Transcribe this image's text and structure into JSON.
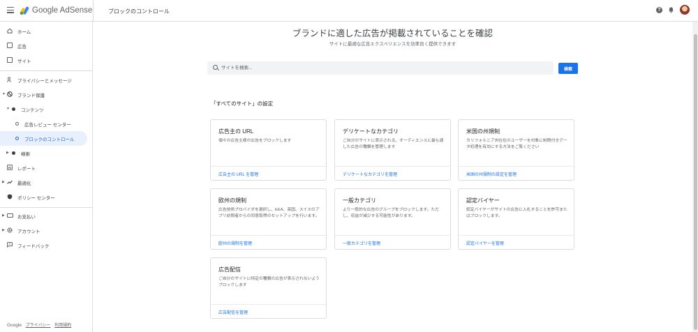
{
  "app": {
    "brand": "Google AdSense",
    "page_title": "ブロックのコントロール"
  },
  "sidebar": {
    "items": [
      {
        "label": "ホーム",
        "icon": "home-icon"
      },
      {
        "label": "広告",
        "icon": "ads-icon"
      },
      {
        "label": "サイト",
        "icon": "sites-icon"
      },
      {
        "label": "プライバシーとメッセージ",
        "icon": "privacy-icon"
      },
      {
        "label": "ブランド保護",
        "icon": "block-icon"
      },
      {
        "label": "コンテンツ",
        "icon": "dot-icon"
      },
      {
        "label": "広告レビュー センター",
        "icon": "ring-icon"
      },
      {
        "label": "ブロックのコントロール",
        "icon": "ring-icon"
      },
      {
        "label": "検索",
        "icon": "dot-icon"
      },
      {
        "label": "レポート",
        "icon": "reports-icon"
      },
      {
        "label": "最適化",
        "icon": "trending-icon"
      },
      {
        "label": "ポリシー センター",
        "icon": "policy-shield-icon"
      },
      {
        "label": "お支払い",
        "icon": "payments-icon"
      },
      {
        "label": "アカウント",
        "icon": "gear-icon"
      },
      {
        "label": "フィードバック",
        "icon": "feedback-icon"
      }
    ],
    "footer": {
      "google": "Google",
      "privacy": "プライバシー",
      "terms": "利用規約"
    }
  },
  "main": {
    "title": "ブランドに適した広告が掲載されていることを確認",
    "subtitle": "サイトに最適な広告エクスペリエンスを効率良く提供できます",
    "search_placeholder": "サイトを検索...",
    "search_button": "検索",
    "section_title": "「すべてのサイト」の設定",
    "cards": [
      {
        "title": "広告主の URL",
        "desc": "個々の広告主様の広告をブロックします",
        "link": "広告主の URL を管理"
      },
      {
        "title": "デリケートなカテゴリ",
        "desc": "ご自分のサイトに表示される、オーディエンスに最も適した広告の種類を管理します",
        "link": "デリケートなカテゴリを管理"
      },
      {
        "title": "米国の州規制",
        "desc": "カリフォルニア州在住のユーザーを対象に制限付きデータ処理を有効にする方法をご覧ください",
        "link": "米国の州規制の設定を管理"
      },
      {
        "title": "欧州の規制",
        "desc": "広告技術プロバイダを選択し、EEA、英国、スイスのアプリ訪問者からの同意取得のセットアップを行います。",
        "link": "欧州の規制を管理"
      },
      {
        "title": "一般カテゴリ",
        "desc": "より一般的な広告のグループをブロックします。ただし、収益が減少する可能性があります。",
        "link": "一般カテゴリを管理"
      },
      {
        "title": "認定バイヤー",
        "desc": "認定バイヤーがサイトの広告に入札することを許可またはブロックします。",
        "link": "認定バイヤーを管理"
      },
      {
        "title": "広告配信",
        "desc": "ご自分のサイトに特定の種類の広告が表示されないようブロックします",
        "link": "広告配信を管理"
      }
    ]
  },
  "colors": {
    "accent": "#1a73e8",
    "active_bg": "#e8f0fe",
    "active_text": "#1967d2"
  }
}
